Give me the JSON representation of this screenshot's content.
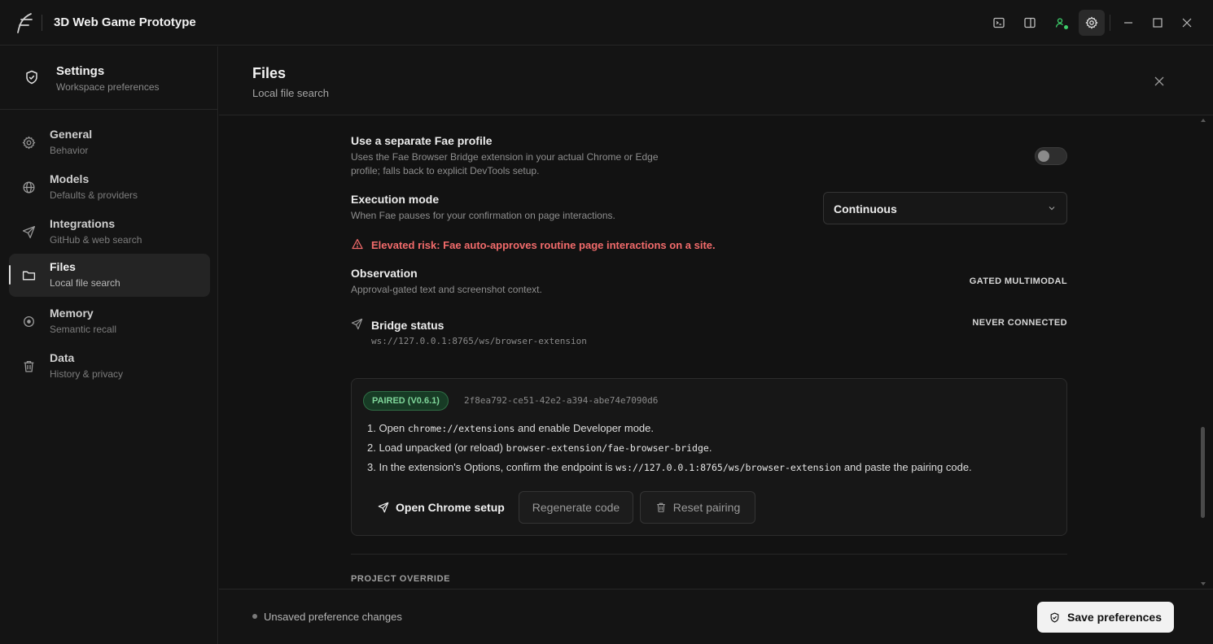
{
  "app": {
    "title": "3D Web Game Prototype"
  },
  "sidebar": {
    "header": {
      "title": "Settings",
      "subtitle": "Workspace preferences"
    },
    "items": [
      {
        "label": "General",
        "sub": "Behavior",
        "icon": "gear-icon"
      },
      {
        "label": "Models",
        "sub": "Defaults & providers",
        "icon": "globe-icon"
      },
      {
        "label": "Integrations",
        "sub": "GitHub & web search",
        "icon": "send-icon"
      },
      {
        "label": "Files",
        "sub": "Local file search",
        "icon": "folder-icon",
        "active": true
      },
      {
        "label": "Memory",
        "sub": "Semantic recall",
        "icon": "target-icon"
      },
      {
        "label": "Data",
        "sub": "History & privacy",
        "icon": "trash-icon"
      }
    ]
  },
  "main": {
    "title": "Files",
    "subtitle": "Local file search",
    "profile": {
      "title": "Use a separate Fae profile",
      "desc_line1": "Uses the Fae Browser Bridge extension in your actual Chrome or Edge",
      "desc_line2": "profile; falls back to explicit DevTools setup.",
      "enabled": false
    },
    "execution": {
      "title": "Execution mode",
      "desc": "When Fae pauses for your confirmation on page interactions.",
      "value": "Continuous"
    },
    "warning": "Elevated risk: Fae auto-approves routine page interactions on a site.",
    "observation": {
      "title": "Observation",
      "desc": "Approval-gated text and screenshot context.",
      "badge": "GATED MULTIMODAL"
    },
    "bridge": {
      "title": "Bridge status",
      "url": "ws://127.0.0.1:8765/ws/browser-extension",
      "badge": "NEVER CONNECTED"
    },
    "pairing": {
      "badge": "PAIRED (V0.6.1)",
      "code": "2f8ea792-ce51-42e2-a394-abe74e7090d6",
      "step1_a": "1. Open ",
      "step1_code": "chrome://extensions",
      "step1_b": " and enable Developer mode.",
      "step2_a": "2. Load unpacked (or reload) ",
      "step2_code": "browser-extension/fae-browser-bridge",
      "step2_b": ".",
      "step3_a": "3. In the extension's Options, confirm the endpoint is ",
      "step3_code": "ws://127.0.0.1:8765/ws/browser-extension",
      "step3_b": " and paste the pairing code.",
      "open_label": "Open Chrome setup",
      "regen_label": "Regenerate code",
      "reset_label": "Reset pairing"
    },
    "section_label": "PROJECT OVERRIDE"
  },
  "footer": {
    "status": "Unsaved preference changes",
    "save_label": "Save preferences"
  }
}
